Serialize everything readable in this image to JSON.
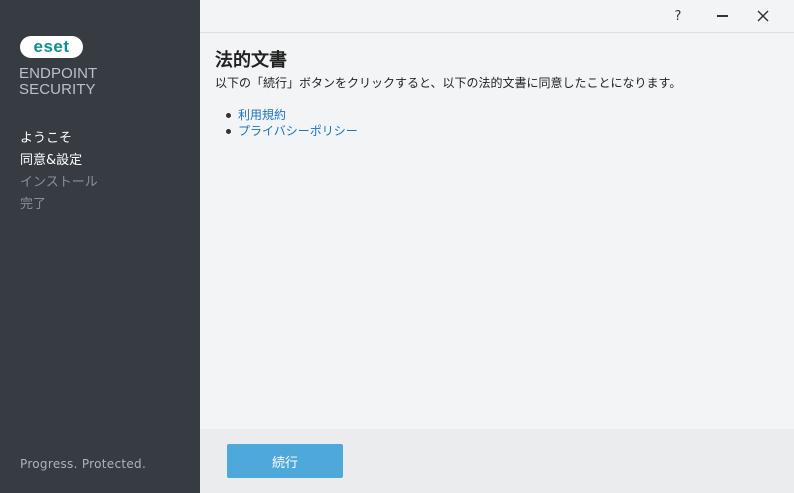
{
  "brand": {
    "logo_text": "eset",
    "product_line1": "ENDPOINT",
    "product_line2": "SECURITY",
    "tagline": "Progress. Protected.",
    "accent_color": "#0f8f8f"
  },
  "steps": [
    {
      "label": "ようこそ",
      "state": "done"
    },
    {
      "label": "同意&設定",
      "state": "active"
    },
    {
      "label": "インストール",
      "state": "pending"
    },
    {
      "label": "完了",
      "state": "pending"
    }
  ],
  "titlebar": {
    "help_label": "?",
    "minimize_icon": "minimize-icon",
    "close_icon": "close-icon"
  },
  "main": {
    "title": "法的文書",
    "description": "以下の「続行」ボタンをクリックすると、以下の法的文書に同意したことになります。",
    "links": [
      {
        "label": "利用規約"
      },
      {
        "label": "プライバシーポリシー"
      }
    ]
  },
  "footer": {
    "continue_label": "続行",
    "button_color": "#4ea8da"
  }
}
